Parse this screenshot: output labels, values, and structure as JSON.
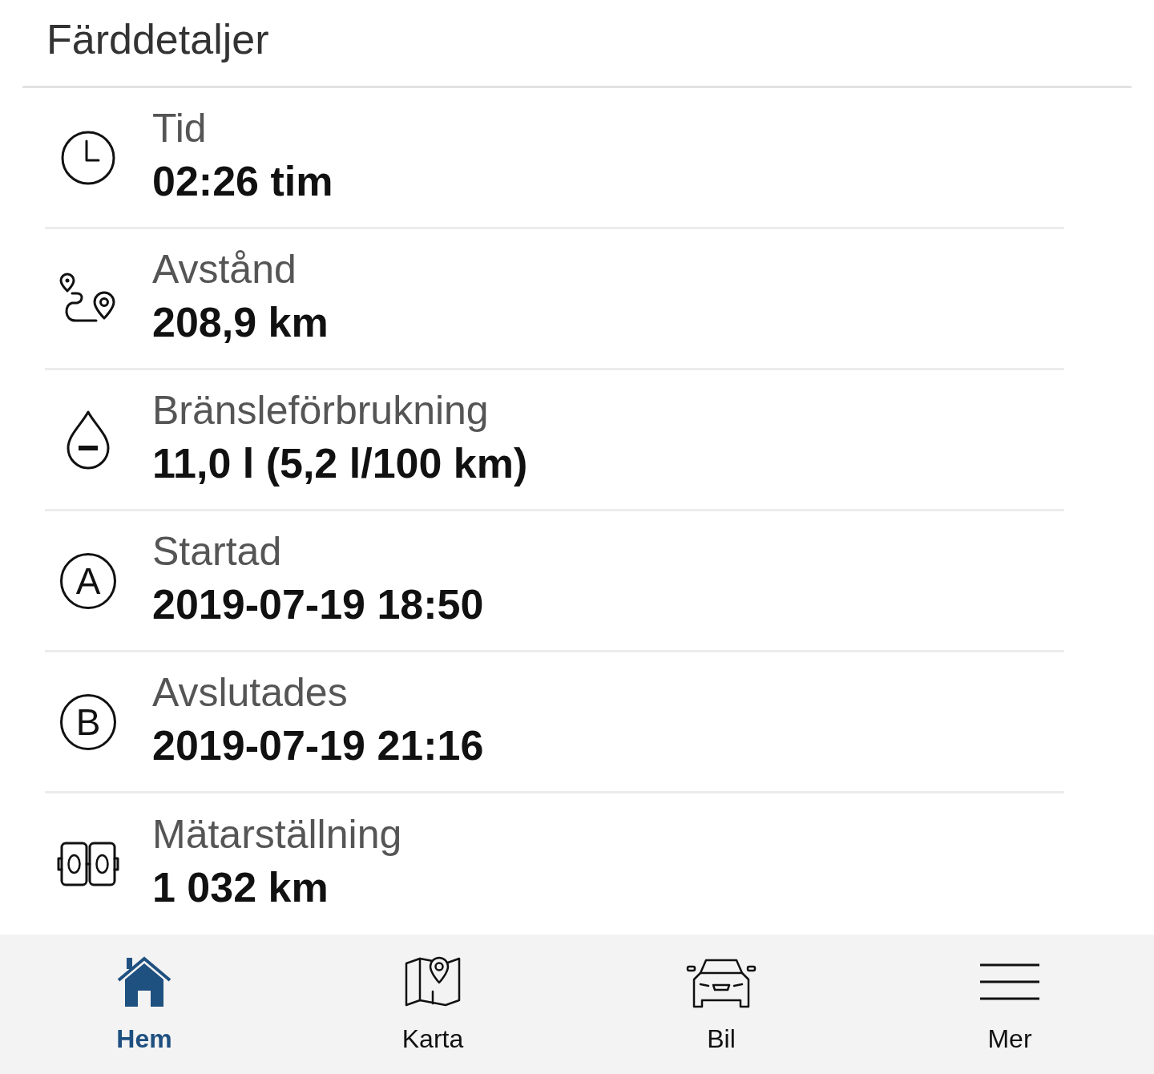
{
  "header": {
    "title": "Färddetaljer"
  },
  "details": [
    {
      "kind": "clock",
      "label": "Tid",
      "value": "02:26 tim"
    },
    {
      "kind": "route",
      "label": "Avstånd",
      "value": "208,9 km"
    },
    {
      "kind": "drop",
      "label": "Bränsleförbrukning",
      "value": "11,0 l (5,2 l/100 km)"
    },
    {
      "kind": "letter",
      "glyph": "A",
      "label": "Startad",
      "value": "2019-07-19 18:50"
    },
    {
      "kind": "letter",
      "glyph": "B",
      "label": "Avslutades",
      "value": "2019-07-19 21:16"
    },
    {
      "kind": "odometer",
      "label": "Mätarställning",
      "value": "1 032 km"
    }
  ],
  "tab_bar": [
    {
      "kind": "home",
      "label": "Hem",
      "selected": true
    },
    {
      "kind": "map",
      "label": "Karta",
      "selected": false
    },
    {
      "kind": "car",
      "label": "Bil",
      "selected": false
    },
    {
      "kind": "menu",
      "label": "Mer",
      "selected": false
    }
  ]
}
